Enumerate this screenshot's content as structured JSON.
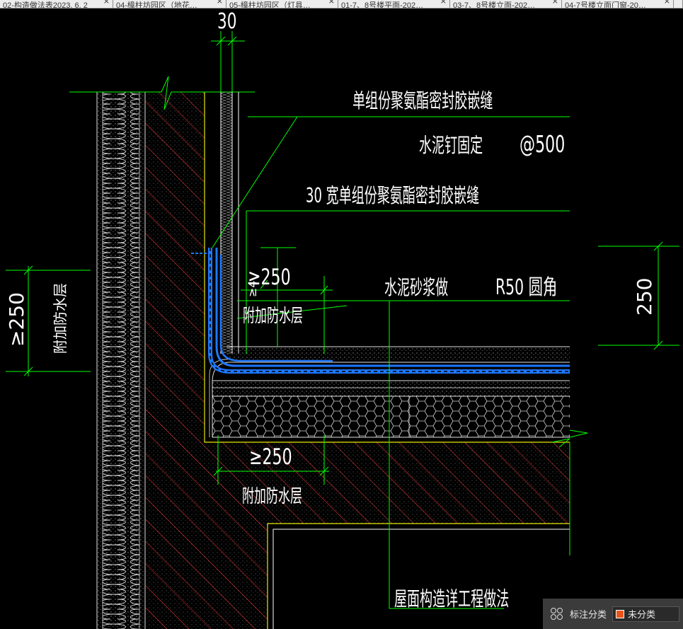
{
  "tabs": [
    {
      "label": "02-构造做法表2023. 6. 2"
    },
    {
      "label": "04-樟柱坊园区（地花…"
    },
    {
      "label": "05-樟柱坊园区（灯具…"
    },
    {
      "label": "01-7、8号楼平面-202…"
    },
    {
      "label": "03-7、8号楼立面-202…"
    },
    {
      "label": "04-7号楼立面门窗-20…"
    }
  ],
  "tab_close_glyph": "×",
  "drawing": {
    "dim_top": "30",
    "callout_1": "单组份聚氨酯密封胶嵌缝",
    "callout_2_text": "水泥钉固定",
    "callout_2_spacing": "@500",
    "callout_3": "30 宽单组份聚氨酯密封胶嵌缝",
    "dim_upper_250": "≥250",
    "dim_small": "≥4",
    "callout_4_text": "水泥砂浆做",
    "callout_4_radius": "R50 圆角",
    "label_extra_upper": "附加防水层",
    "dim_right_250": "250",
    "dim_left_250": "≥250",
    "label_left_vertical": "附加防水层",
    "dim_lower_250": "≥250",
    "label_extra_lower": "附加防水层",
    "label_bottom": "屋面构造详工程做法"
  },
  "status": {
    "label": "标注分类",
    "value": "未分类",
    "swatch_color": "#e8541a"
  },
  "colors": {
    "line_green": "#00ff00",
    "hatch_red": "#ff3b3b",
    "membrane_blue": "#1e78ff",
    "concrete_yellow": "#e8e800"
  }
}
